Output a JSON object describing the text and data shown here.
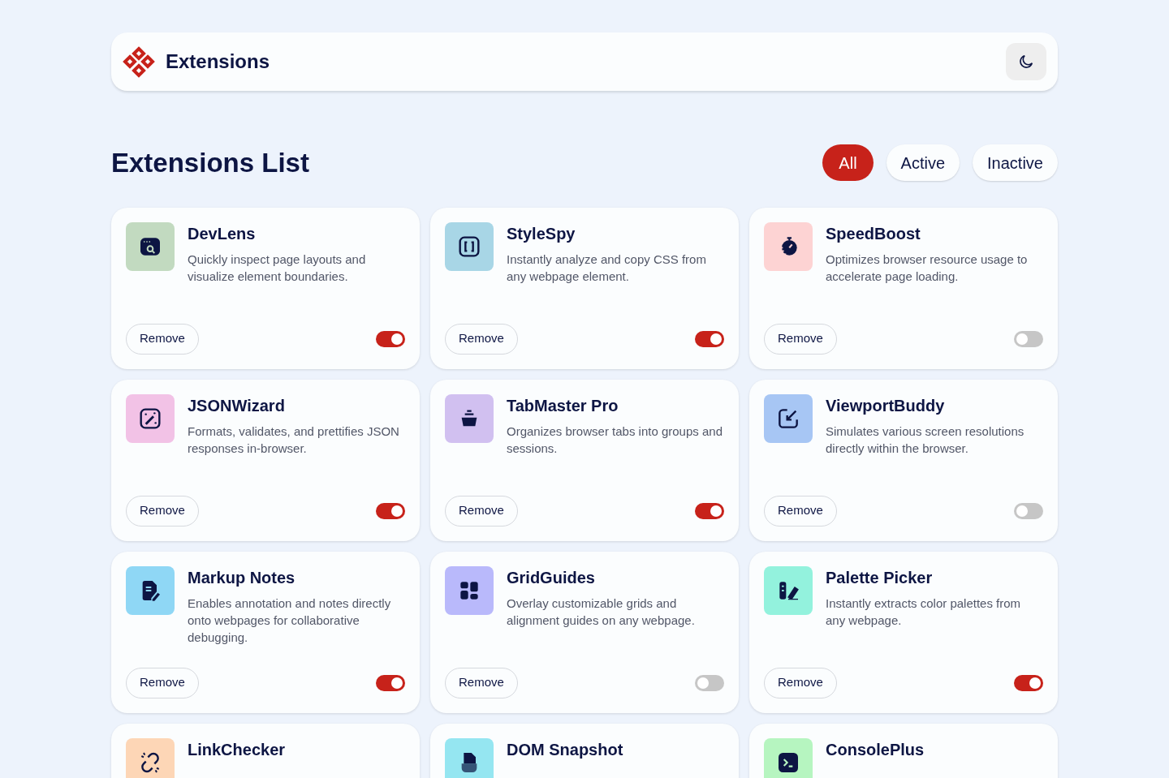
{
  "header": {
    "title": "Extensions"
  },
  "heading": "Extensions List",
  "filters": [
    {
      "label": "All",
      "selected": true
    },
    {
      "label": "Active",
      "selected": false
    },
    {
      "label": "Inactive",
      "selected": false
    }
  ],
  "extensions": [
    {
      "kind": "browser",
      "name": "DevLens",
      "description": "Quickly inspect page layouts and visualize element boundaries.",
      "color": "#c2dac0",
      "button": "Remove",
      "on": true
    },
    {
      "kind": "brackets",
      "name": "StyleSpy",
      "description": "Instantly analyze and copy CSS from any webpage element.",
      "color": "#a8d6e6",
      "button": "Remove",
      "on": true
    },
    {
      "kind": "stopwatch",
      "name": "SpeedBoost",
      "description": "Optimizes browser resource usage to accelerate page loading.",
      "color": "#fdd3d3",
      "button": "Remove",
      "on": false
    },
    {
      "kind": "wand",
      "name": "JSONWizard",
      "description": "Formats, validates, and prettifies JSON responses in-browser.",
      "color": "#f2c2e6",
      "button": "Remove",
      "on": true
    },
    {
      "kind": "basket",
      "name": "TabMaster Pro",
      "description": "Organizes browser tabs into groups and sessions.",
      "color": "#d1c0f0",
      "button": "Remove",
      "on": true
    },
    {
      "kind": "resize",
      "name": "ViewportBuddy",
      "description": "Simulates various screen resolutions directly within the browser.",
      "color": "#a7c6f4",
      "button": "Remove",
      "on": false
    },
    {
      "kind": "note",
      "name": "Markup Notes",
      "description": "Enables annotation and notes directly onto webpages for collaborative debugging.",
      "color": "#8fd7f5",
      "button": "Remove",
      "on": true
    },
    {
      "kind": "grid",
      "name": "GridGuides",
      "description": "Overlay customizable grids and alignment guides on any webpage.",
      "color": "#b9b9fb",
      "button": "Remove",
      "on": false
    },
    {
      "kind": "palette",
      "name": "Palette Picker",
      "description": "Instantly extracts color palettes from any webpage.",
      "color": "#93f2dd",
      "button": "Remove",
      "on": true
    },
    {
      "kind": "link",
      "name": "LinkChecker",
      "color": "#fdd6b6"
    },
    {
      "kind": "snapshot",
      "name": "DOM Snapshot",
      "color": "#95e6f1"
    },
    {
      "kind": "console",
      "name": "ConsolePlus",
      "color": "#b6f5c0"
    }
  ]
}
